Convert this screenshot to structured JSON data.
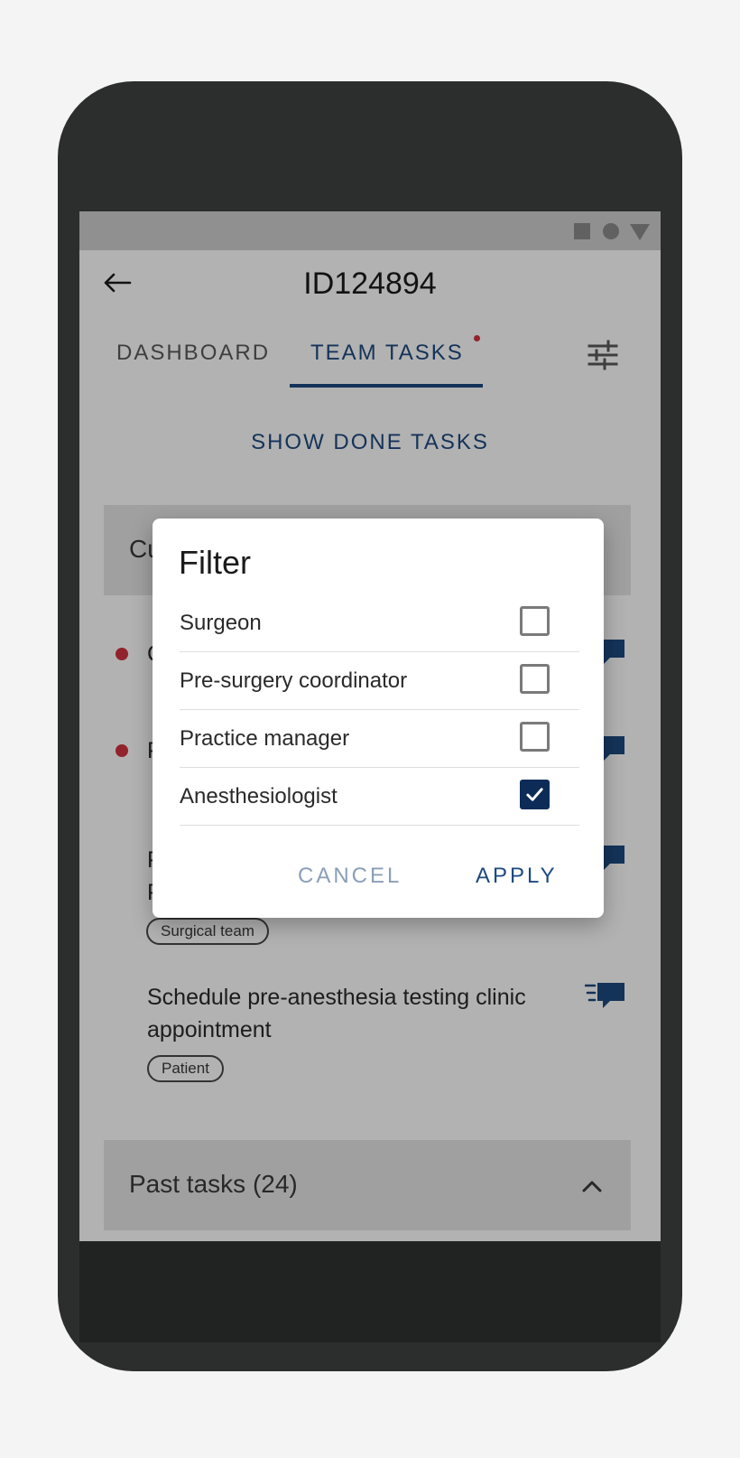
{
  "app": {
    "title": "ID124894"
  },
  "tabs": [
    {
      "label": "DASHBOARD",
      "active": false
    },
    {
      "label": "TEAM TASKS",
      "active": true,
      "has_notification": true
    }
  ],
  "show_done_label": "SHOW DONE TASKS",
  "sections": {
    "current": {
      "label": "Cu"
    },
    "past": {
      "label": "Past tasks (24)"
    }
  },
  "tasks": [
    {
      "text": "C",
      "unread": true
    },
    {
      "text": "P",
      "unread": true
    },
    {
      "text": "P",
      "line2": "P",
      "chip": "Surgical team",
      "unread": false
    },
    {
      "text": "Schedule pre-anesthesia testing clinic appointment",
      "chip": "Patient",
      "unread": false
    }
  ],
  "dialog": {
    "title": "Filter",
    "options": [
      {
        "label": "Surgeon",
        "checked": false
      },
      {
        "label": "Pre-surgery coordinator",
        "checked": false
      },
      {
        "label": "Practice manager",
        "checked": false
      },
      {
        "label": "Anesthesiologist",
        "checked": true
      }
    ],
    "cancel_label": "CANCEL",
    "apply_label": "APPLY"
  },
  "colors": {
    "accent": "#1e4a80",
    "checkbox_checked": "#0d2b57",
    "unread_dot": "#d2313f",
    "phone_frame": "#2c2d2d"
  },
  "icons": [
    "arrow-left-icon",
    "filter-sliders-icon",
    "chat-list-icon",
    "chevron-up-icon",
    "check-icon"
  ]
}
